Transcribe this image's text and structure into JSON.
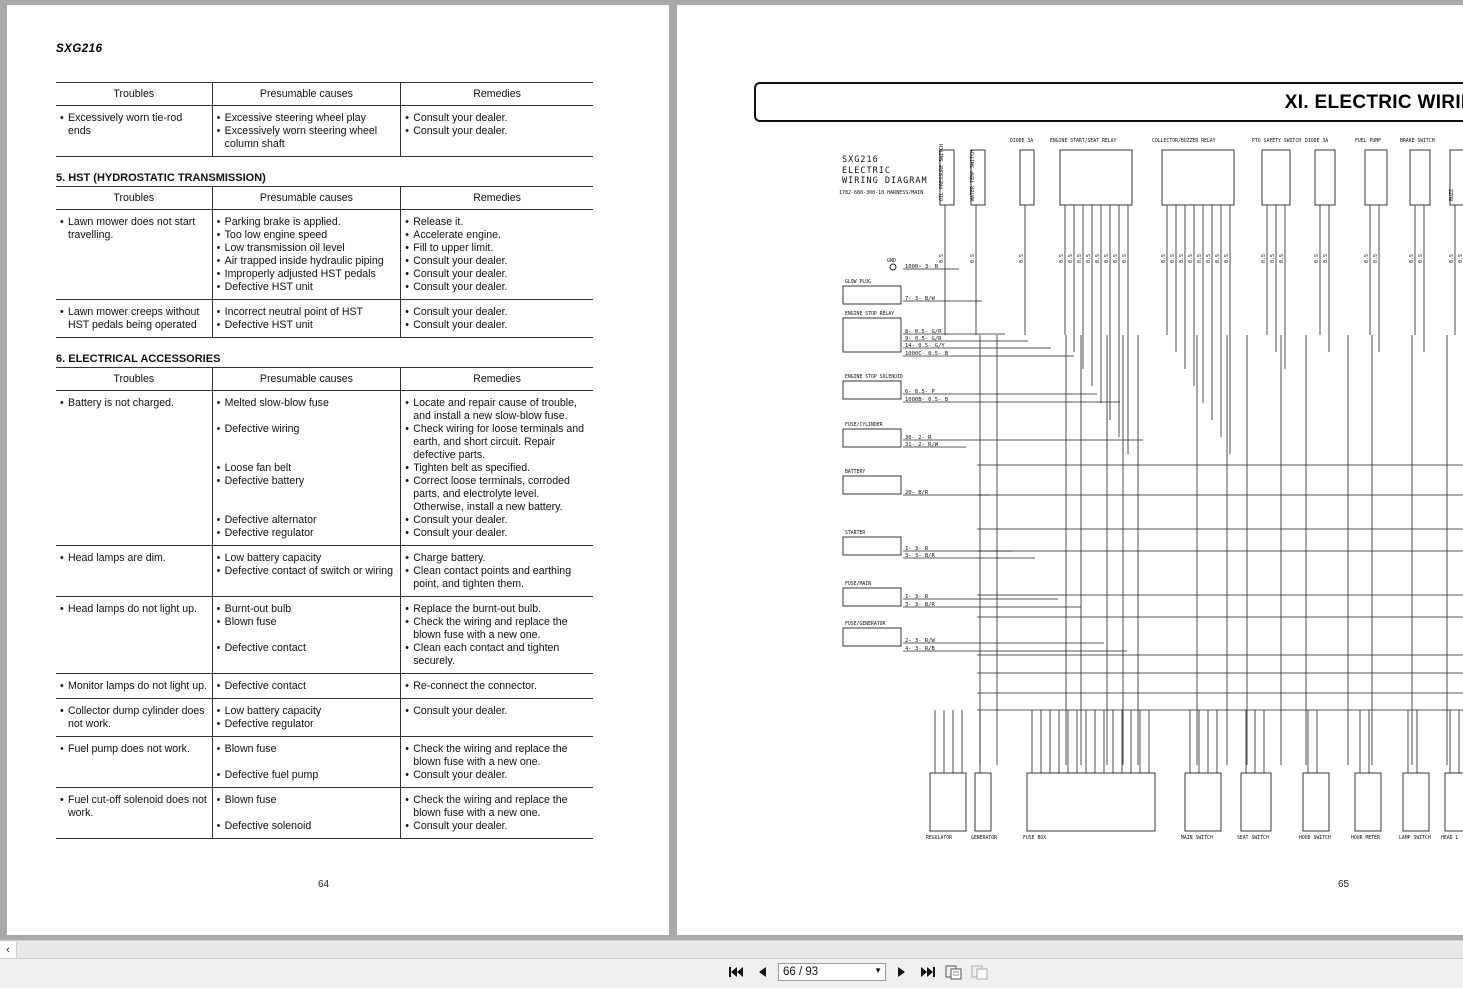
{
  "left_page": {
    "model": "SXG216",
    "page_number": "64",
    "col_headers": [
      "Troubles",
      "Presumable causes",
      "Remedies"
    ],
    "table1_rows": [
      {
        "troubles": [
          "Excessively worn tie-rod ends"
        ],
        "causes": [
          "Excessive steering wheel play",
          "Excessively worn steering wheel column shaft"
        ],
        "remedies": [
          "Consult your dealer.",
          "Consult your dealer."
        ]
      }
    ],
    "section5_title": "5. HST (HYDROSTATIC TRANSMISSION)",
    "table5_rows": [
      {
        "troubles": [
          "Lawn mower does not start travelling."
        ],
        "causes": [
          "Parking brake is applied.",
          "Too low engine speed",
          "Low transmission oil level",
          "Air trapped inside hydraulic piping",
          "Improperly adjusted HST pedals",
          "Defective HST unit"
        ],
        "remedies": [
          "Release it.",
          "Accelerate engine.",
          "Fill to upper limit.",
          "Consult your dealer.",
          "Consult your dealer.",
          "Consult your dealer."
        ]
      },
      {
        "troubles": [
          "Lawn mower creeps  without HST pedals being  operated"
        ],
        "causes": [
          "Incorrect neutral point of HST",
          "Defective HST unit"
        ],
        "remedies": [
          "Consult your dealer.",
          "Consult your dealer."
        ]
      }
    ],
    "section6_title": "6. ELECTRICAL ACCESSORIES",
    "table6_rows": [
      {
        "troubles": [
          "Battery is not charged."
        ],
        "causes": [
          "Melted slow-blow fuse",
          "",
          "Defective wiring",
          "",
          "",
          "Loose fan belt",
          "Defective battery",
          "",
          "",
          "Defective alternator",
          "Defective regulator"
        ],
        "remedies": [
          "Locate and repair cause of trouble, and install a new slow-blow fuse.",
          "Check wiring for loose terminals and earth, and short circuit. Repair defective parts.",
          "Tighten belt as specified.",
          "Correct loose terminals, corroded parts, and electrolyte level. Otherwise, install a new battery.",
          "Consult your dealer.",
          "Consult your dealer."
        ]
      },
      {
        "troubles": [
          "Head lamps are dim."
        ],
        "causes": [
          "Low battery capacity",
          "Defective contact of switch or wiring"
        ],
        "remedies": [
          "Charge battery.",
          "Clean contact points and earthing point, and tighten them."
        ]
      },
      {
        "troubles": [
          "Head lamps do not light up."
        ],
        "causes": [
          "Burnt-out bulb",
          "Blown fuse",
          "",
          "Defective contact"
        ],
        "remedies": [
          "Replace the burnt-out bulb.",
          "Check the wiring and replace the blown fuse with a new one.",
          "Clean each contact and tighten securely."
        ]
      },
      {
        "troubles": [
          "Monitor lamps do not light up."
        ],
        "causes": [
          "Defective contact"
        ],
        "remedies": [
          "Re-connect the connector."
        ]
      },
      {
        "troubles": [
          "Collector dump cylinder does not work."
        ],
        "causes": [
          "Low battery capacity",
          "Defective regulator"
        ],
        "remedies": [
          "Consult your dealer."
        ]
      },
      {
        "troubles": [
          "Fuel pump does not work."
        ],
        "causes": [
          "Blown fuse",
          "",
          "Defective fuel pump"
        ],
        "remedies": [
          "Check the wiring and replace the blown fuse with a new one.",
          "Consult your dealer."
        ]
      },
      {
        "troubles": [
          "Fuel cut-off solenoid does not work."
        ],
        "causes": [
          "Blown fuse",
          "",
          "Defective solenoid"
        ],
        "remedies": [
          "Check the wiring and replace the blown fuse with a new one.",
          "Consult your dealer."
        ]
      }
    ]
  },
  "right_page": {
    "header_title": "XI. ELECTRIC WIRING",
    "diagram_title": "SXG216\nELECTRIC\nWIRING DIAGRAM",
    "diagram_subtitle": "1782-680-300-10 HARNESS/MAIN",
    "page_number": "65",
    "top_labels": [
      "OIL PRESSURE SWITCH",
      "WATER TEMP SWITCH",
      "DIODE 3A",
      "ENGINE START/SEAT RELAY",
      "COLLECTOR/BUZZER RELAY",
      "PTO SAFETY SWITCH",
      "DIODE 3A",
      "FUEL PUMP",
      "BRAKE SWITCH",
      "BUZZ"
    ],
    "left_labels": [
      "GND",
      "GLOW PLUG",
      "ENGINE STOP RELAY",
      "ENGINE STOP SOLENOID",
      "FUSE/CYLINDER",
      "BATTERY",
      "STARTER",
      "FUSE/MAIN",
      "FUSE/GENERATOR"
    ],
    "bottom_labels": [
      "REGULATOR",
      "GENERATOR",
      "FUSE BOX",
      "MAIN SWITCH",
      "SEAT SWITCH",
      "HOOD SWITCH",
      "HOUR METER",
      "LAMP SWITCH",
      "HEAD L"
    ],
    "wire_codes_left": [
      "1000- 3- B",
      "7- 3- B/W",
      "8- 0.5- G/R",
      "9- 0.5- G/R",
      "14- 0.5- G/Y",
      "1000C- 0.5- B",
      "6- 0.5- P",
      "1000B- 0.5- B",
      "30- 2- R",
      "31- 2- R/W",
      "20- B/R",
      "1- 3- R",
      "3- 3- B/R",
      "1- 3- R",
      "3- 3- B/R",
      "2- 3- R/W",
      "4- 3- R/B"
    ]
  },
  "toolbar": {
    "page_input": "66 / 93",
    "first_icon": "first-page-icon",
    "prev_icon": "prev-page-icon",
    "next_icon": "next-page-icon",
    "last_icon": "last-page-icon",
    "view_icon_1": "two-page-view-icon",
    "view_icon_2": "single-page-view-icon"
  }
}
